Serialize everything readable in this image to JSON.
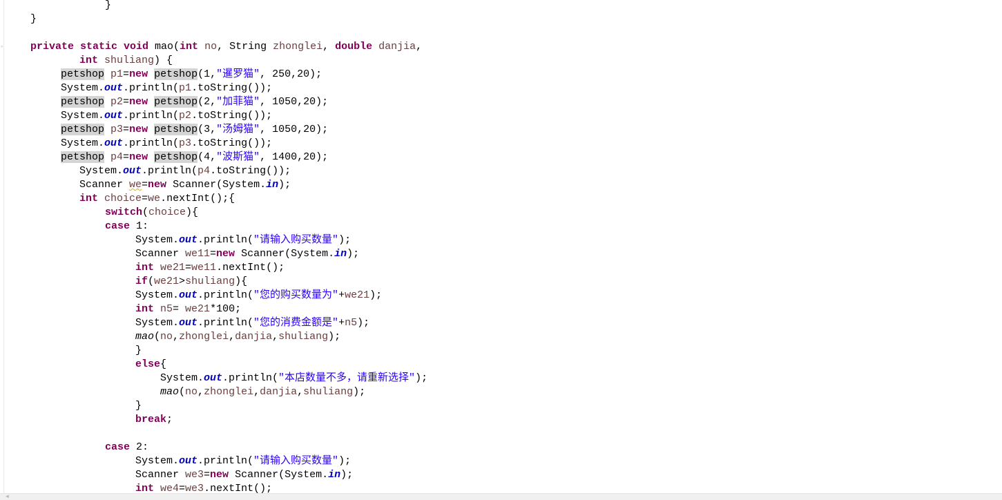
{
  "editor": {
    "lines": [
      {
        "indent": 152,
        "tokens": [
          [
            "p",
            "}"
          ]
        ]
      },
      {
        "indent": 44,
        "tokens": [
          [
            "p",
            "}"
          ]
        ]
      },
      {
        "indent": 44,
        "tokens": []
      },
      {
        "indent": 44,
        "tokens": [
          [
            "k",
            "private static void "
          ],
          [
            "p",
            "mao("
          ],
          [
            "k",
            "int "
          ],
          [
            "v",
            "no"
          ],
          [
            "p",
            ", String "
          ],
          [
            "v",
            "zhonglei"
          ],
          [
            "p",
            ", "
          ],
          [
            "k",
            "double "
          ],
          [
            "v",
            "danjia"
          ],
          [
            "p",
            ","
          ]
        ]
      },
      {
        "indent": 115,
        "tokens": [
          [
            "k",
            "int "
          ],
          [
            "v",
            "shuliang"
          ],
          [
            "p",
            ") {"
          ]
        ]
      },
      {
        "indent": 88,
        "tokens": [
          [
            "h",
            "petshop"
          ],
          [
            "p",
            " "
          ],
          [
            "v",
            "p1"
          ],
          [
            "p",
            "="
          ],
          [
            "k",
            "new "
          ],
          [
            "h",
            "petshop"
          ],
          [
            "p",
            "(1,"
          ],
          [
            "s",
            "\"暹罗猫\""
          ],
          [
            "p",
            ", 250,20);"
          ]
        ]
      },
      {
        "indent": 88,
        "tokens": [
          [
            "p",
            "System."
          ],
          [
            "f",
            "out"
          ],
          [
            "p",
            ".println("
          ],
          [
            "v",
            "p1"
          ],
          [
            "p",
            ".toString());"
          ]
        ]
      },
      {
        "indent": 88,
        "tokens": [
          [
            "h",
            "petshop"
          ],
          [
            "p",
            " "
          ],
          [
            "v",
            "p2"
          ],
          [
            "p",
            "="
          ],
          [
            "k",
            "new "
          ],
          [
            "h",
            "petshop"
          ],
          [
            "p",
            "(2,"
          ],
          [
            "s",
            "\"加菲猫\""
          ],
          [
            "p",
            ", 1050,20);"
          ]
        ]
      },
      {
        "indent": 88,
        "tokens": [
          [
            "p",
            "System."
          ],
          [
            "f",
            "out"
          ],
          [
            "p",
            ".println("
          ],
          [
            "v",
            "p2"
          ],
          [
            "p",
            ".toString());"
          ]
        ]
      },
      {
        "indent": 88,
        "tokens": [
          [
            "h",
            "petshop"
          ],
          [
            "p",
            " "
          ],
          [
            "v",
            "p3"
          ],
          [
            "p",
            "="
          ],
          [
            "k",
            "new "
          ],
          [
            "h",
            "petshop"
          ],
          [
            "p",
            "(3,"
          ],
          [
            "s",
            "\"汤姆猫\""
          ],
          [
            "p",
            ", 1050,20);"
          ]
        ]
      },
      {
        "indent": 88,
        "tokens": [
          [
            "p",
            "System."
          ],
          [
            "f",
            "out"
          ],
          [
            "p",
            ".println("
          ],
          [
            "v",
            "p3"
          ],
          [
            "p",
            ".toString());"
          ]
        ]
      },
      {
        "indent": 88,
        "tokens": [
          [
            "h",
            "petshop"
          ],
          [
            "p",
            " "
          ],
          [
            "v",
            "p4"
          ],
          [
            "p",
            "="
          ],
          [
            "k",
            "new "
          ],
          [
            "h",
            "petshop"
          ],
          [
            "p",
            "(4,"
          ],
          [
            "s",
            "\"波斯猫\""
          ],
          [
            "p",
            ", 1400,20);"
          ]
        ]
      },
      {
        "indent": 115,
        "tokens": [
          [
            "p",
            "System."
          ],
          [
            "f",
            "out"
          ],
          [
            "p",
            ".println("
          ],
          [
            "v",
            "p4"
          ],
          [
            "p",
            ".toString());"
          ]
        ]
      },
      {
        "indent": 115,
        "tokens": [
          [
            "p",
            "Scanner "
          ],
          [
            "w",
            "we"
          ],
          [
            "p",
            "="
          ],
          [
            "k",
            "new "
          ],
          [
            "p",
            "Scanner(System."
          ],
          [
            "f",
            "in"
          ],
          [
            "p",
            ");"
          ]
        ]
      },
      {
        "indent": 115,
        "tokens": [
          [
            "k",
            "int "
          ],
          [
            "v",
            "choice"
          ],
          [
            "p",
            "="
          ],
          [
            "v",
            "we"
          ],
          [
            "p",
            ".nextInt();{"
          ]
        ]
      },
      {
        "indent": 152,
        "tokens": [
          [
            "k",
            "switch"
          ],
          [
            "p",
            "("
          ],
          [
            "v",
            "choice"
          ],
          [
            "p",
            "){"
          ]
        ]
      },
      {
        "indent": 152,
        "tokens": [
          [
            "k",
            "case "
          ],
          [
            "p",
            "1:"
          ]
        ]
      },
      {
        "indent": 196,
        "tokens": [
          [
            "p",
            "System."
          ],
          [
            "f",
            "out"
          ],
          [
            "p",
            ".println("
          ],
          [
            "s",
            "\"请输入购买数量\""
          ],
          [
            "p",
            ");"
          ]
        ]
      },
      {
        "indent": 196,
        "tokens": [
          [
            "p",
            "Scanner "
          ],
          [
            "v",
            "we11"
          ],
          [
            "p",
            "="
          ],
          [
            "k",
            "new "
          ],
          [
            "p",
            "Scanner(System."
          ],
          [
            "f",
            "in"
          ],
          [
            "p",
            ");"
          ]
        ]
      },
      {
        "indent": 196,
        "tokens": [
          [
            "k",
            "int "
          ],
          [
            "v",
            "we21"
          ],
          [
            "p",
            "="
          ],
          [
            "v",
            "we11"
          ],
          [
            "p",
            ".nextInt();"
          ]
        ]
      },
      {
        "indent": 196,
        "tokens": [
          [
            "k",
            "if"
          ],
          [
            "p",
            "("
          ],
          [
            "v",
            "we21"
          ],
          [
            "p",
            ">"
          ],
          [
            "v",
            "shuliang"
          ],
          [
            "p",
            "){"
          ]
        ]
      },
      {
        "indent": 196,
        "tokens": [
          [
            "p",
            "System."
          ],
          [
            "f",
            "out"
          ],
          [
            "p",
            ".println("
          ],
          [
            "s",
            "\"您的购买数量为\""
          ],
          [
            "p",
            "+"
          ],
          [
            "v",
            "we21"
          ],
          [
            "p",
            ");"
          ]
        ]
      },
      {
        "indent": 196,
        "tokens": [
          [
            "k",
            "int "
          ],
          [
            "v",
            "n5"
          ],
          [
            "p",
            "= "
          ],
          [
            "v",
            "we21"
          ],
          [
            "p",
            "*100;"
          ]
        ]
      },
      {
        "indent": 196,
        "tokens": [
          [
            "p",
            "System."
          ],
          [
            "f",
            "out"
          ],
          [
            "p",
            ".println("
          ],
          [
            "s",
            "\"您的消费金额是\""
          ],
          [
            "p",
            "+"
          ],
          [
            "v",
            "n5"
          ],
          [
            "p",
            ");"
          ]
        ]
      },
      {
        "indent": 196,
        "tokens": [
          [
            "m",
            "mao"
          ],
          [
            "p",
            "("
          ],
          [
            "v",
            "no"
          ],
          [
            "p",
            ","
          ],
          [
            "v",
            "zhonglei"
          ],
          [
            "p",
            ","
          ],
          [
            "v",
            "danjia"
          ],
          [
            "p",
            ","
          ],
          [
            "v",
            "shuliang"
          ],
          [
            "p",
            ");"
          ]
        ]
      },
      {
        "indent": 196,
        "tokens": [
          [
            "p",
            "}"
          ]
        ]
      },
      {
        "indent": 196,
        "tokens": [
          [
            "k",
            "else"
          ],
          [
            "p",
            "{"
          ]
        ]
      },
      {
        "indent": 232,
        "tokens": [
          [
            "p",
            "System."
          ],
          [
            "f",
            "out"
          ],
          [
            "p",
            ".println("
          ],
          [
            "s",
            "\"本店数量不多，请重新选择\""
          ],
          [
            "p",
            ");"
          ]
        ]
      },
      {
        "indent": 232,
        "tokens": [
          [
            "m",
            "mao"
          ],
          [
            "p",
            "("
          ],
          [
            "v",
            "no"
          ],
          [
            "p",
            ","
          ],
          [
            "v",
            "zhonglei"
          ],
          [
            "p",
            ","
          ],
          [
            "v",
            "danjia"
          ],
          [
            "p",
            ","
          ],
          [
            "v",
            "shuliang"
          ],
          [
            "p",
            ");"
          ]
        ]
      },
      {
        "indent": 196,
        "tokens": [
          [
            "p",
            "}"
          ]
        ]
      },
      {
        "indent": 196,
        "tokens": [
          [
            "k",
            "break"
          ],
          [
            "p",
            ";"
          ]
        ]
      },
      {
        "indent": 196,
        "tokens": []
      },
      {
        "indent": 152,
        "tokens": [
          [
            "k",
            "case "
          ],
          [
            "p",
            "2:"
          ]
        ]
      },
      {
        "indent": 196,
        "tokens": [
          [
            "p",
            "System."
          ],
          [
            "f",
            "out"
          ],
          [
            "p",
            ".println("
          ],
          [
            "s",
            "\"请输入购买数量\""
          ],
          [
            "p",
            ");"
          ]
        ]
      },
      {
        "indent": 196,
        "tokens": [
          [
            "p",
            "Scanner "
          ],
          [
            "v",
            "we3"
          ],
          [
            "p",
            "="
          ],
          [
            "k",
            "new "
          ],
          [
            "p",
            "Scanner(System."
          ],
          [
            "f",
            "in"
          ],
          [
            "p",
            ");"
          ]
        ]
      },
      {
        "indent": 196,
        "tokens": [
          [
            "k",
            "int "
          ],
          [
            "v",
            "we4"
          ],
          [
            "p",
            "="
          ],
          [
            "v",
            "we3"
          ],
          [
            "p",
            ".nextInt();"
          ]
        ]
      }
    ]
  }
}
